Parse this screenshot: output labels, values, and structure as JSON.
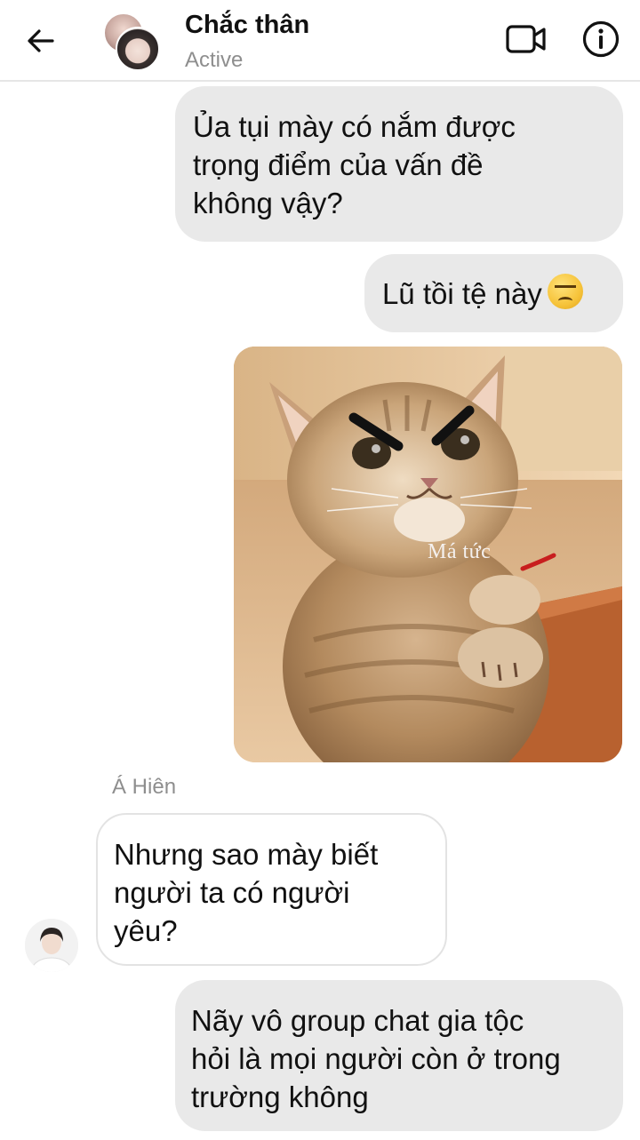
{
  "header": {
    "contact_name": "Chắc thân",
    "status": "Active",
    "back_icon": "arrow-left-icon",
    "video_icon": "video-camera-icon",
    "info_icon": "info-icon"
  },
  "messages": [
    {
      "direction": "outgoing",
      "type": "text",
      "lines": [
        "Ủa tụi mày có nắm được",
        "trọng điểm của vấn đề",
        "không vậy?"
      ]
    },
    {
      "direction": "outgoing",
      "type": "text",
      "text": "Lũ tồi tệ này",
      "emoji": "angry-face-emoji"
    },
    {
      "direction": "outgoing",
      "type": "image",
      "caption": "Má tức"
    },
    {
      "direction": "incoming",
      "type": "text",
      "sender": "Á Hiên",
      "lines": [
        "Nhưng sao mày biết",
        "người ta có người",
        "yêu?"
      ]
    },
    {
      "direction": "outgoing",
      "type": "text",
      "lines": [
        "Nãy vô group chat gia tộc",
        "hỏi là mọi người còn ở trong",
        "trường không"
      ]
    }
  ],
  "colors": {
    "outgoing_bubble": "#e9e9e9",
    "incoming_bubble": "#ffffff",
    "muted_text": "#8e8e8e"
  }
}
